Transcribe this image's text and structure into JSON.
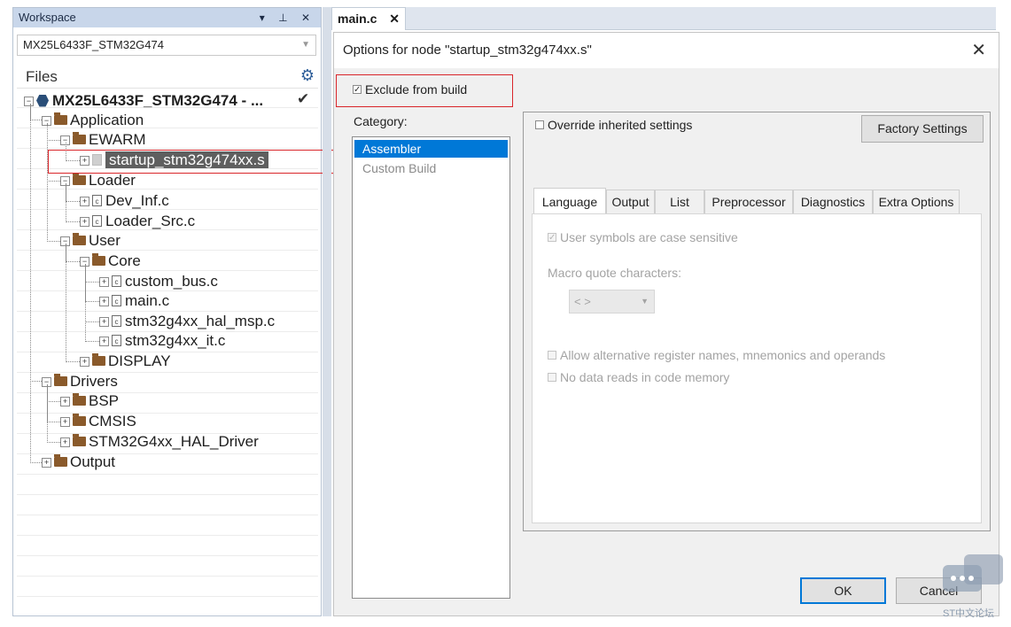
{
  "workspace": {
    "title": "Workspace",
    "title_buttons": "▾ ⊥ ✕",
    "project_combo": "MX25L6433F_STM32G474",
    "files_header": "Files",
    "tree": {
      "project": "MX25L6433F_STM32G474 - ...",
      "application": "Application",
      "ewarm": "EWARM",
      "startup": "startup_stm32g474xx.s",
      "loader": "Loader",
      "dev_inf": "Dev_Inf.c",
      "loader_src": "Loader_Src.c",
      "user": "User",
      "core": "Core",
      "custom_bus": "custom_bus.c",
      "main_c": "main.c",
      "hal_msp": "stm32g4xx_hal_msp.c",
      "it_c": "stm32g4xx_it.c",
      "display": "DISPLAY",
      "drivers": "Drivers",
      "bsp": "BSP",
      "cmsis": "CMSIS",
      "hal_driver": "STM32G4xx_HAL_Driver",
      "output": "Output"
    }
  },
  "editor": {
    "tab_label": "main.c"
  },
  "dialog": {
    "title": "Options for node \"startup_stm32g474xx.s\"",
    "exclude_label": "Exclude from build",
    "category_label": "Category:",
    "categories": [
      "Assembler",
      "Custom Build"
    ],
    "override_label": "Override inherited settings",
    "factory_button": "Factory Settings",
    "tabs": [
      "Language",
      "Output",
      "List",
      "Preprocessor",
      "Diagnostics",
      "Extra Options"
    ],
    "case_sensitive_label": "User symbols are case sensitive",
    "macro_label": "Macro quote characters:",
    "macro_value": "< >",
    "alt_register_label": "Allow alternative register names, mnemonics and operands",
    "no_data_reads_label": "No data reads in code memory",
    "ok_label": "OK",
    "cancel_label": "Cancel"
  },
  "watermark": {
    "text": "ST中文论坛"
  },
  "colors": {
    "selection_blue": "#0078d7",
    "highlight_red": "#d9252a",
    "workspace_title_bg": "#c8d6ea",
    "folder_brown": "#8a5a2b"
  }
}
